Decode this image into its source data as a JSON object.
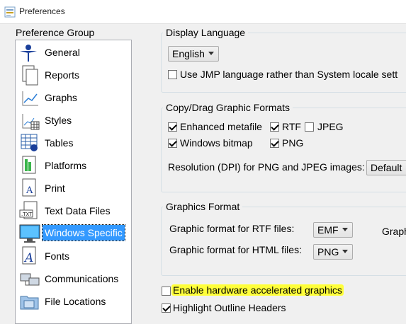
{
  "window": {
    "title": "Preferences"
  },
  "sidebar": {
    "header": "Preference Group",
    "items": [
      {
        "label": "General",
        "icon": "general-icon"
      },
      {
        "label": "Reports",
        "icon": "reports-icon"
      },
      {
        "label": "Graphs",
        "icon": "graphs-icon"
      },
      {
        "label": "Styles",
        "icon": "styles-icon"
      },
      {
        "label": "Tables",
        "icon": "tables-icon"
      },
      {
        "label": "Platforms",
        "icon": "platforms-icon"
      },
      {
        "label": "Print",
        "icon": "print-icon"
      },
      {
        "label": "Text Data Files",
        "icon": "text-data-files-icon"
      },
      {
        "label": "Windows Specific",
        "icon": "windows-specific-icon",
        "selected": true
      },
      {
        "label": "Fonts",
        "icon": "fonts-icon"
      },
      {
        "label": "Communications",
        "icon": "communications-icon"
      },
      {
        "label": "File Locations",
        "icon": "file-locations-icon"
      }
    ]
  },
  "display_language": {
    "legend": "Display Language",
    "language_value": "English",
    "use_jmp_language_label": "Use JMP language rather than System locale sett",
    "use_jmp_language_checked": false
  },
  "copy_drag": {
    "legend": "Copy/Drag Graphic Formats",
    "enhanced_metafile": {
      "label": "Enhanced metafile",
      "checked": true
    },
    "rtf": {
      "label": "RTF",
      "checked": true
    },
    "jpeg": {
      "label": "JPEG",
      "checked": false
    },
    "windows_bitmap": {
      "label": "Windows bitmap",
      "checked": true
    },
    "png": {
      "label": "PNG",
      "checked": true
    },
    "resolution_label": "Resolution (DPI) for PNG and JPEG images:",
    "resolution_value": "Default"
  },
  "graphics_format": {
    "legend": "Graphics Format",
    "rtf_label": "Graphic format for RTF files:",
    "rtf_value": "EMF",
    "html_label": "Graphic format for HTML files:",
    "html_value": "PNG",
    "cut_label": "Graph"
  },
  "options": {
    "hardware_accel": {
      "label": "Enable hardware accelerated graphics",
      "checked": false,
      "highlight_color": "#ffff3a"
    },
    "highlight_outline": {
      "label": "Highlight Outline Headers",
      "checked": true
    }
  }
}
